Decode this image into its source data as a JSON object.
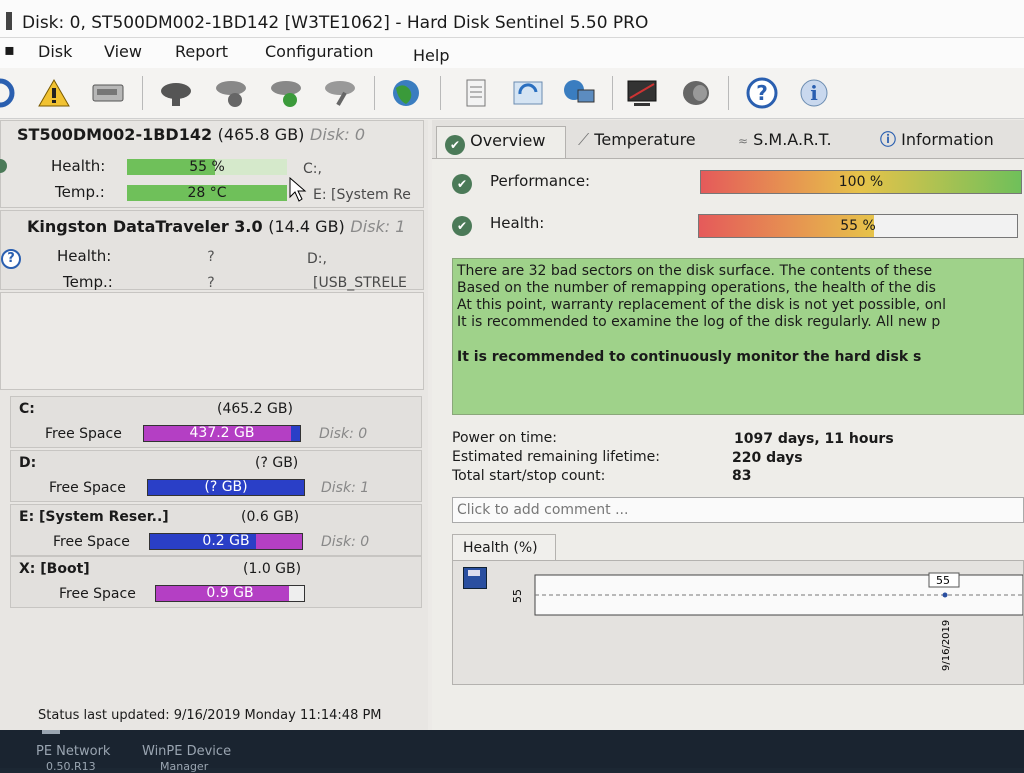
{
  "window": {
    "title": "Disk: 0, ST500DM002-1BD142 [W3TE1062]  -  Hard Disk Sentinel 5.50 PRO"
  },
  "menu": {
    "disk": "Disk",
    "view": "View",
    "report": "Report",
    "configuration": "Configuration",
    "help": "Help"
  },
  "disks": [
    {
      "model": "ST500DM002-1BD142",
      "size": "(465.8 GB)",
      "disk_label": "Disk: 0",
      "health_label": "Health:",
      "health_value": "55 %",
      "health_fraction": 0.55,
      "temp_label": "Temp.:",
      "temp_value": "28 °C",
      "drive_letter": "C:,",
      "partition": "E: [System Re"
    },
    {
      "model": "Kingston DataTraveler 3.0",
      "size": "(14.4 GB)",
      "disk_label": "Disk: 1",
      "health_label": "Health:",
      "health_value": "?",
      "temp_label": "Temp.:",
      "temp_value": "?",
      "drive_letter": "D:,",
      "partition": "[USB_STRELE"
    }
  ],
  "volumes": [
    {
      "name": "C:",
      "size": "(465.2 GB)",
      "free_label": "Free Space",
      "free_value": "437.2 GB",
      "disk_label": "Disk: 0",
      "free_fraction": 0.94
    },
    {
      "name": "D:",
      "size": "(? GB)",
      "free_label": "Free Space",
      "free_value": "(? GB)",
      "disk_label": "Disk: 1",
      "free_fraction": 1.0
    },
    {
      "name": "E: [System Reser..]",
      "size": "(0.6 GB)",
      "free_label": "Free Space",
      "free_value": "0.2 GB",
      "disk_label": "Disk: 0",
      "free_fraction": 0.7
    },
    {
      "name": "X: [Boot]",
      "size": "(1.0 GB)",
      "free_label": "Free Space",
      "free_value": "0.9 GB",
      "disk_label": "",
      "free_fraction": 0.9
    }
  ],
  "status": {
    "last_updated": "Status last updated: 9/16/2019 Monday 11:14:48 PM"
  },
  "tabs": {
    "overview": "Overview",
    "temperature": "Temperature",
    "smart": "S.M.A.R.T.",
    "information": "Information"
  },
  "overview": {
    "performance_label": "Performance:",
    "performance_value": "100 %",
    "performance_fraction": 1.0,
    "health_label": "Health:",
    "health_value": "55 %",
    "health_fraction": 0.55,
    "message_lines": [
      "There are 32 bad sectors on the disk surface. The contents of these",
      "Based on the number of remapping operations, the health of the dis",
      "At this point, warranty replacement of the disk is not yet possible, onl",
      "It is recommended to examine the log of the disk regularly. All new p"
    ],
    "message_bold": "It is recommended to continuously monitor the hard disk s",
    "power_on_label": "Power on time:",
    "power_on_value": "1097 days, 11 hours",
    "lifetime_label": "Estimated remaining lifetime:",
    "lifetime_value": "220 days",
    "startstop_label": "Total start/stop count:",
    "startstop_value": "83",
    "comment_placeholder": "Click to add comment ..."
  },
  "chart_data": {
    "type": "line",
    "title": "Health (%)",
    "ylabel": "",
    "xlabel": "",
    "x": [
      "9/16/2019"
    ],
    "series": [
      {
        "values": [
          55
        ]
      }
    ],
    "y_tick": "55",
    "point_label": "55"
  },
  "taskbar": {
    "item1": "PE Network",
    "item2": "WinPE Device",
    "item1_sub": "0.50.R13",
    "item2_sub": "Manager"
  },
  "colors": {
    "health_green": "#6fc05a",
    "volume_purple": "#b43fc4",
    "volume_blue": "#2a3fc7",
    "message_bg": "#9fd28a"
  }
}
